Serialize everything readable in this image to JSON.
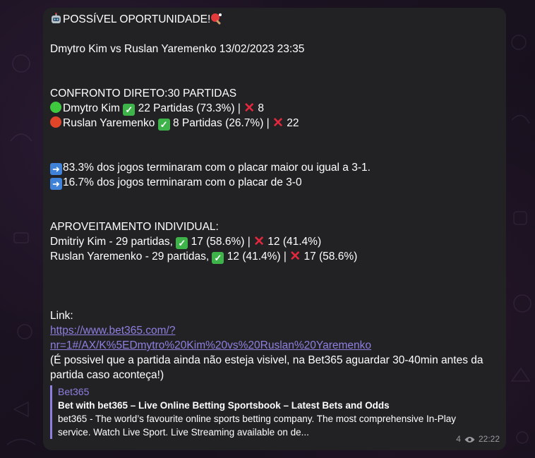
{
  "message": {
    "header": "POSSÍVEL OPORTUNIDADE!",
    "matchup": "Dmytro Kim vs Ruslan Yaremenko 13/02/2023 23:35",
    "h2h_title": "CONFRONTO DIRETO:30 PARTIDAS",
    "h2h_p1_name": "Dmytro Kim",
    "h2h_p1_wins": " 22 Partidas (73.3%) | ",
    "h2h_p1_losses": " 8",
    "h2h_p2_name": "Ruslan Yaremenko",
    "h2h_p2_wins": " 8 Partidas (26.7%) | ",
    "h2h_p2_losses": " 22",
    "stat1": "83.3% dos jogos terminaram com o placar maior ou igual a 3-1.",
    "stat2": "16.7% dos jogos terminaram com o placar de 3-0",
    "indiv_title": "APROVEITAMENTO INDIVIDUAL:",
    "indiv_p1": "Dmitriy Kim - 29 partidas, ",
    "indiv_p1_wins": " 17 (58.6%) | ",
    "indiv_p1_losses": " 12 (41.4%)",
    "indiv_p2": "Ruslan Yaremenko - 29 partidas, ",
    "indiv_p2_wins": " 12 (41.4%) | ",
    "indiv_p2_losses": " 17 (58.6%)",
    "link_label": "Link:",
    "link_line1": "https://www.bet365.com/?",
    "link_line2": "nr=1#/AX/K%5EDmytro%20Kim%20vs%20Ruslan%20Yaremenko",
    "note": "(É possivel que a partida ainda não esteja visivel, na Bet365 aguardar 30-40min antes da partida caso aconteça!)"
  },
  "preview": {
    "site": "Bet365",
    "title": "Bet with bet365 – Live Online Betting Sportsbook – Latest Bets and Odds",
    "description": "bet365 - The world’s favourite online sports betting company. The most comprehensive In-Play service. Watch Live Sport. Live Streaming available on de..."
  },
  "meta": {
    "views": "4",
    "time": "22:22"
  },
  "colors": {
    "bubble": "#222225",
    "link": "#8f7fe0",
    "meta": "#9b9ba0"
  },
  "icons": [
    "robot-emoji-icon",
    "ping-pong-emoji-icon",
    "green-circle-icon",
    "red-circle-icon",
    "check-mark-icon",
    "cross-mark-icon",
    "right-arrow-icon",
    "eye-icon"
  ]
}
